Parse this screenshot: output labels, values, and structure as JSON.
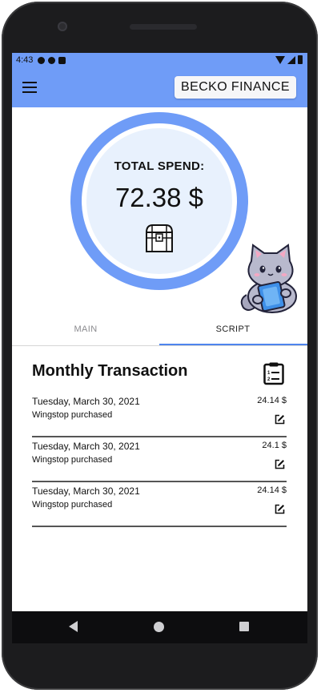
{
  "status_bar": {
    "time": "4:43"
  },
  "app_bar": {
    "brand_label": "BECKO FINANCE"
  },
  "summary": {
    "label": "TOTAL SPEND:",
    "value": "72.38 $"
  },
  "tabs": [
    {
      "label": "MAIN",
      "selected": false
    },
    {
      "label": "SCRIPT",
      "selected": true
    }
  ],
  "transactions": {
    "title": "Monthly Transaction",
    "items": [
      {
        "date": "Tuesday, March 30, 2021",
        "description": "Wingstop purchased",
        "amount": "24.14 $"
      },
      {
        "date": "Tuesday, March 30, 2021",
        "description": "Wingstop purchased",
        "amount": "24.1 $"
      },
      {
        "date": "Tuesday, March 30, 2021",
        "description": "Wingstop purchased",
        "amount": "24.14 $"
      }
    ]
  },
  "icons": {
    "menu": "menu-icon",
    "chest": "treasure-chest-icon",
    "mascot": "cat-mascot",
    "clipboard": "clipboard-list-icon",
    "edit": "edit-icon"
  },
  "colors": {
    "accent": "#6f9cf7",
    "ring_core": "#e8f1fd",
    "tab_indicator": "#4e84ee"
  }
}
